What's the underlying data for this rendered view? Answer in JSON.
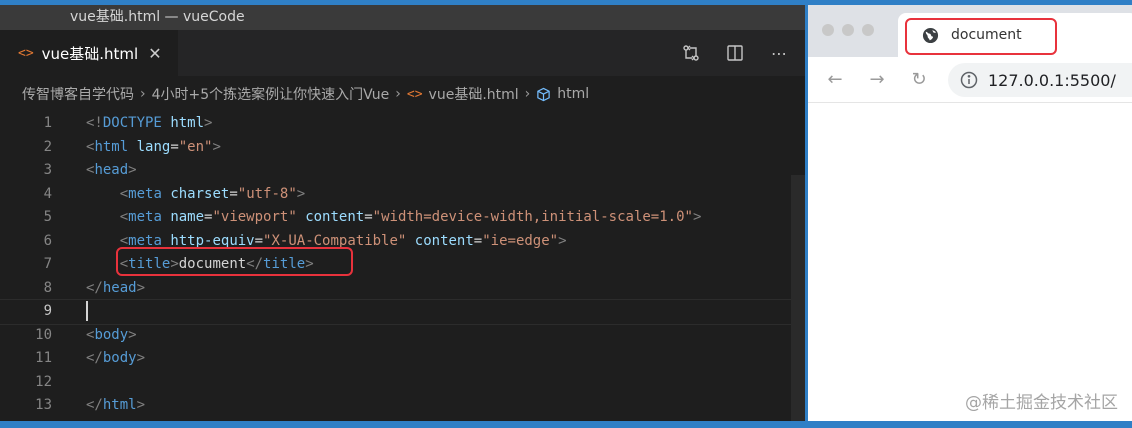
{
  "editor": {
    "window_title": "vue基础.html — vueCode",
    "tab": {
      "label": "vue基础.html",
      "icon": "html-file-icon"
    },
    "actions": [
      "compare-changes-icon",
      "split-editor-icon",
      "more-actions-icon"
    ],
    "breadcrumb": [
      "传智博客自学代码",
      "4小时+5个拣选案例让你快速入门Vue",
      "vue基础.html",
      "html"
    ],
    "lines": [
      {
        "n": "1",
        "tokens": [
          [
            "br",
            "<!"
          ],
          [
            "tag",
            "DOCTYPE"
          ],
          [
            "txt",
            " "
          ],
          [
            "attr",
            "html"
          ],
          [
            "br",
            ">"
          ]
        ]
      },
      {
        "n": "2",
        "tokens": [
          [
            "br",
            "<"
          ],
          [
            "tag",
            "html"
          ],
          [
            "txt",
            " "
          ],
          [
            "attr",
            "lang"
          ],
          [
            "txt",
            "="
          ],
          [
            "str",
            "\"en\""
          ],
          [
            "br",
            ">"
          ]
        ]
      },
      {
        "n": "3",
        "tokens": [
          [
            "br",
            "<"
          ],
          [
            "tag",
            "head"
          ],
          [
            "br",
            ">"
          ]
        ]
      },
      {
        "n": "4",
        "tokens": [
          [
            "txt",
            "    "
          ],
          [
            "br",
            "<"
          ],
          [
            "tag",
            "meta"
          ],
          [
            "txt",
            " "
          ],
          [
            "attr",
            "charset"
          ],
          [
            "txt",
            "="
          ],
          [
            "str",
            "\"utf-8\""
          ],
          [
            "br",
            ">"
          ]
        ]
      },
      {
        "n": "5",
        "tokens": [
          [
            "txt",
            "    "
          ],
          [
            "br",
            "<"
          ],
          [
            "tag",
            "meta"
          ],
          [
            "txt",
            " "
          ],
          [
            "attr",
            "name"
          ],
          [
            "txt",
            "="
          ],
          [
            "str",
            "\"viewport\""
          ],
          [
            "txt",
            " "
          ],
          [
            "attr",
            "content"
          ],
          [
            "txt",
            "="
          ],
          [
            "str",
            "\"width=device-width,initial-scale=1.0\""
          ],
          [
            "br",
            ">"
          ]
        ]
      },
      {
        "n": "6",
        "tokens": [
          [
            "txt",
            "    "
          ],
          [
            "br",
            "<"
          ],
          [
            "tag",
            "meta"
          ],
          [
            "txt",
            " "
          ],
          [
            "attr",
            "http-equiv"
          ],
          [
            "txt",
            "="
          ],
          [
            "str",
            "\"X-UA-Compatible\""
          ],
          [
            "txt",
            " "
          ],
          [
            "attr",
            "content"
          ],
          [
            "txt",
            "="
          ],
          [
            "str",
            "\"ie=edge\""
          ],
          [
            "br",
            ">"
          ]
        ]
      },
      {
        "n": "7",
        "tokens": [
          [
            "txt",
            "    "
          ],
          [
            "br",
            "<"
          ],
          [
            "tag",
            "title"
          ],
          [
            "br",
            ">"
          ],
          [
            "txt",
            "document"
          ],
          [
            "br",
            "</"
          ],
          [
            "tag",
            "title"
          ],
          [
            "br",
            ">"
          ]
        ]
      },
      {
        "n": "8",
        "tokens": [
          [
            "br",
            "</"
          ],
          [
            "tag",
            "head"
          ],
          [
            "br",
            ">"
          ]
        ]
      },
      {
        "n": "9",
        "tokens": [],
        "current": true
      },
      {
        "n": "10",
        "tokens": [
          [
            "br",
            "<"
          ],
          [
            "tag",
            "body"
          ],
          [
            "br",
            ">"
          ]
        ]
      },
      {
        "n": "11",
        "tokens": [
          [
            "br",
            "</"
          ],
          [
            "tag",
            "body"
          ],
          [
            "br",
            ">"
          ]
        ]
      },
      {
        "n": "12",
        "tokens": []
      },
      {
        "n": "13",
        "tokens": [
          [
            "br",
            "</"
          ],
          [
            "tag",
            "html"
          ],
          [
            "br",
            ">"
          ]
        ]
      }
    ]
  },
  "browser": {
    "tab_title": "document",
    "url": "127.0.0.1:5500/",
    "nav": [
      "back-icon",
      "forward-icon",
      "reload-icon"
    ]
  },
  "watermark": "@稀土掘金技术社区",
  "colors": {
    "highlight": "#e8323c",
    "accent_border": "#2f7fc6"
  }
}
